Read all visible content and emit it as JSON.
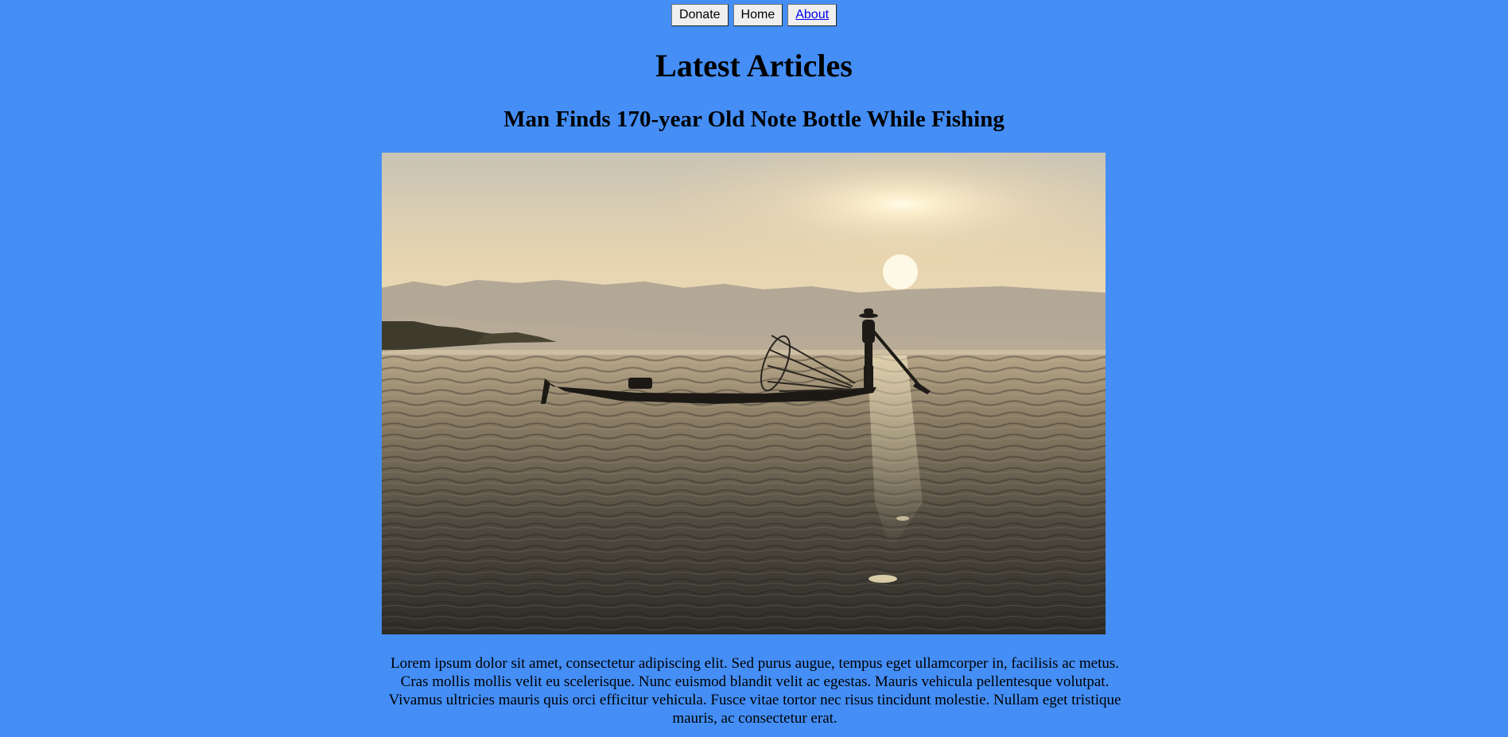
{
  "nav": {
    "donate_label": "Donate",
    "home_label": "Home",
    "about_label": "About"
  },
  "page": {
    "heading": "Latest Articles"
  },
  "article": {
    "title": "Man Finds 170-year Old Note Bottle While Fishing",
    "body": "Lorem ipsum dolor sit amet, consectetur adipiscing elit. Sed purus augue, tempus eget ullamcorper in, facilisis ac metus. Cras mollis mollis velit eu scelerisque. Nunc euismod blandit velit ac egestas. Mauris vehicula pellentesque volutpat. Vivamus ultricies mauris quis orci efficitur vehicula. Fusce vitae tortor nec risus tincidunt molestie. Nullam eget tristique mauris, ac consectetur erat."
  },
  "colors": {
    "background": "#448ef6",
    "link": "#0000ee"
  }
}
